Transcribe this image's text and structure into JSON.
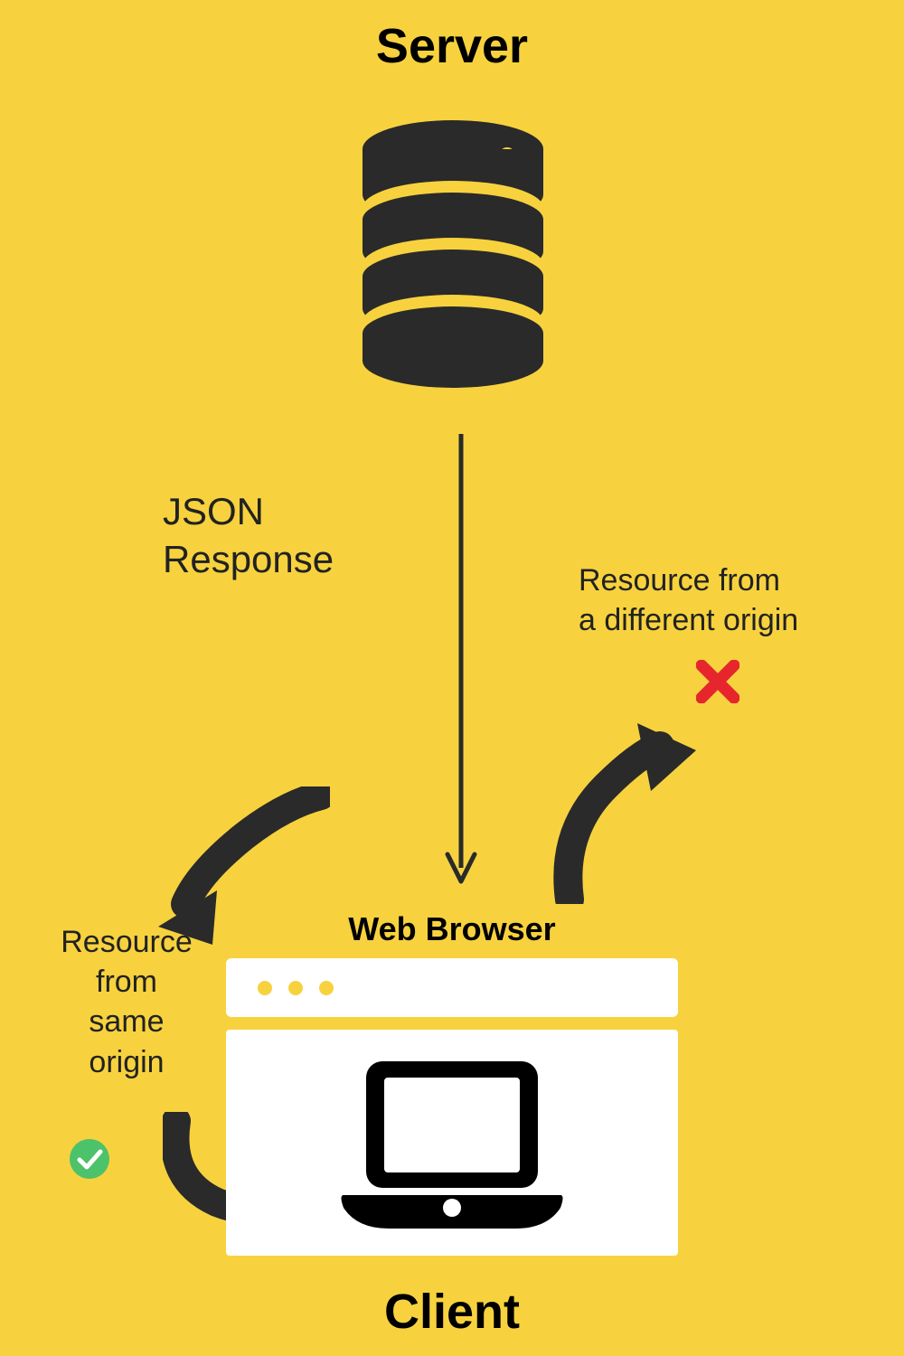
{
  "titles": {
    "server": "Server",
    "client": "Client",
    "browser": "Web Browser"
  },
  "labels": {
    "json_line1": "JSON",
    "json_line2": "Response",
    "diff_line1": "Resource from",
    "diff_line2": "a different origin",
    "same_line1": "Resource",
    "same_line2": "from",
    "same_line3": "same",
    "same_line4": "origin"
  },
  "colors": {
    "background": "#f7d23e",
    "dark": "#2a2a2a",
    "red": "#e6262c",
    "green": "#4cc26a",
    "white": "#ffffff"
  },
  "icons": {
    "server": "database-icon",
    "browser": "browser-window-icon",
    "laptop": "laptop-icon",
    "cross": "x-icon",
    "check": "check-icon",
    "down_arrow": "arrow-down-icon",
    "curve_up_right": "curved-arrow-up-right-icon",
    "curve_down_left": "curved-arrow-down-left-icon",
    "curve_into": "curved-arrow-into-icon"
  }
}
